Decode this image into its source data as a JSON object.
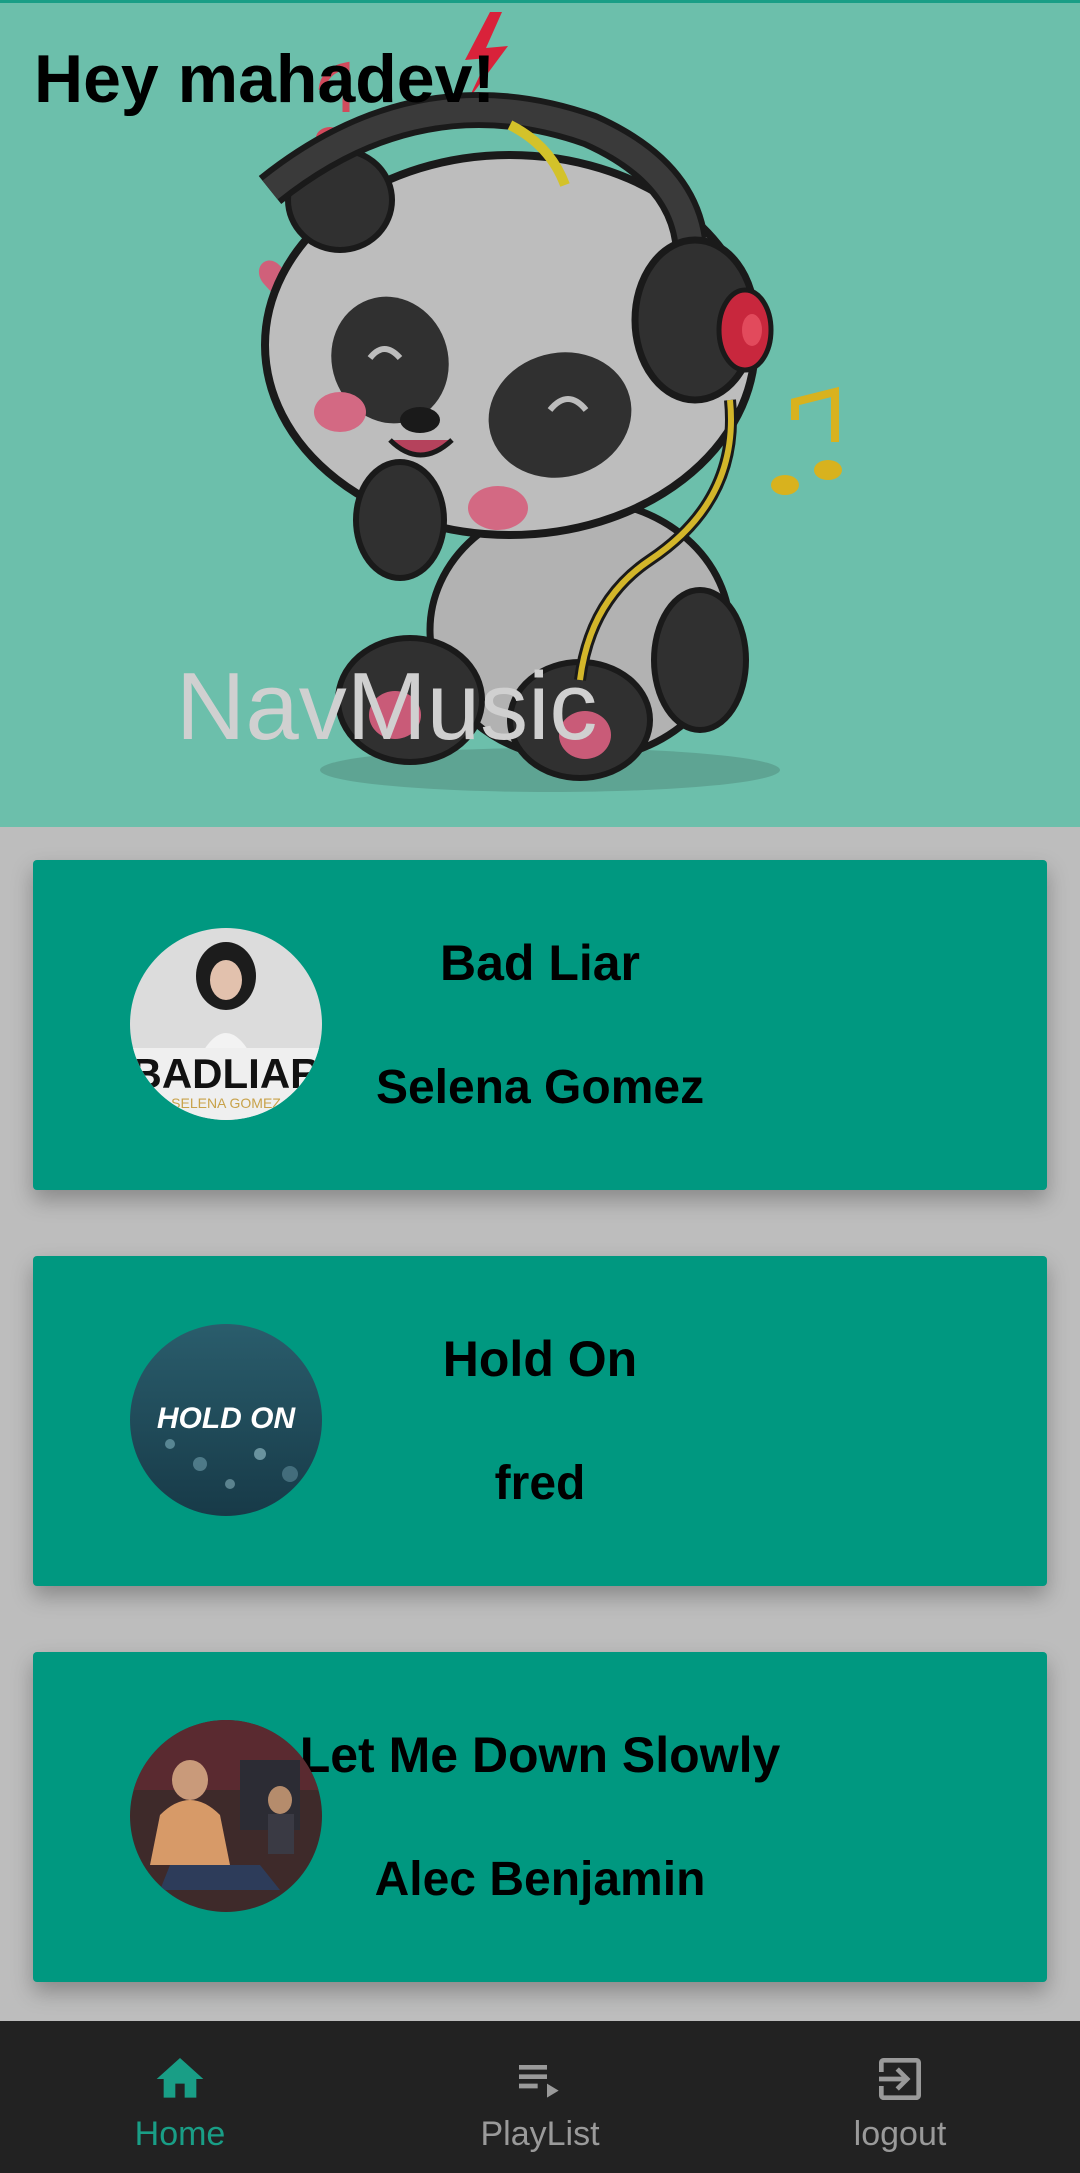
{
  "header": {
    "greeting": "Hey mahadev!",
    "app_name": "NavMusic"
  },
  "songs": [
    {
      "title": "Bad Liar",
      "artist": "Selena Gomez",
      "cover_text": "BADLIAR"
    },
    {
      "title": "Hold On",
      "artist": "fred",
      "cover_text": "HOLD ON"
    },
    {
      "title": "Let Me Down Slowly",
      "artist": "Alec Benjamin"
    }
  ],
  "bottom_nav": {
    "items": [
      {
        "label": "Home",
        "icon": "home-icon",
        "active": true
      },
      {
        "label": "PlayList",
        "icon": "playlist-icon",
        "active": false
      },
      {
        "label": "logout",
        "icon": "logout-icon",
        "active": false
      }
    ]
  },
  "colors": {
    "hero_bg": "#6cbfab",
    "card_bg": "#009880",
    "accent": "#199e86",
    "nav_bg": "#222222",
    "page_bg": "#bdbdbd"
  }
}
